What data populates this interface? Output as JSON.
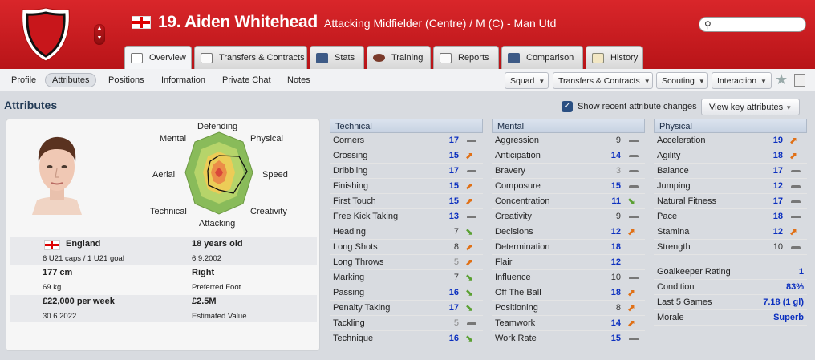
{
  "player": {
    "name": "19. Aiden Whitehead",
    "position": "Attacking Midfielder (Centre) / M (C) - Man Utd",
    "nation": "England",
    "caps": "6 U21 caps / 1 U21 goal",
    "age": "18 years old",
    "dob": "6.9.2002",
    "height": "177 cm",
    "weight": "69 kg",
    "foot": "Right",
    "foot_label": "Preferred Foot",
    "wage": "£22,000 per week",
    "contract": "30.6.2022",
    "value": "£2.5M",
    "value_label": "Estimated Value"
  },
  "tabs": [
    {
      "label": "Overview",
      "icon": "overview-icon"
    },
    {
      "label": "Transfers & Contracts",
      "icon": "document-icon"
    },
    {
      "label": "Stats",
      "icon": "stats-icon"
    },
    {
      "label": "Training",
      "icon": "training-icon"
    },
    {
      "label": "Reports",
      "icon": "reports-icon"
    },
    {
      "label": "Comparison",
      "icon": "comparison-icon"
    },
    {
      "label": "History",
      "icon": "history-icon"
    }
  ],
  "subnav": [
    "Profile",
    "Attributes",
    "Positions",
    "Information",
    "Private Chat",
    "Notes"
  ],
  "dropdowns": [
    "Squad",
    "Transfers & Contracts",
    "Scouting",
    "Interaction"
  ],
  "section_title": "Attributes",
  "show_changes_label": "Show recent attribute changes",
  "view_key_label": "View key attributes",
  "radar_labels": {
    "defending": "Defending",
    "physical": "Physical",
    "speed": "Speed",
    "creativity": "Creativity",
    "attacking": "Attacking",
    "technical": "Technical",
    "aerial": "Aerial",
    "mental": "Mental"
  },
  "technical": {
    "title": "Technical",
    "rows": [
      {
        "name": "Corners",
        "value": "17",
        "trend": "flat"
      },
      {
        "name": "Crossing",
        "value": "15",
        "trend": "up"
      },
      {
        "name": "Dribbling",
        "value": "17",
        "trend": "flat"
      },
      {
        "name": "Finishing",
        "value": "15",
        "trend": "up"
      },
      {
        "name": "First Touch",
        "value": "15",
        "trend": "up"
      },
      {
        "name": "Free Kick Taking",
        "value": "13",
        "trend": "flat"
      },
      {
        "name": "Heading",
        "value": "7",
        "trend": "down"
      },
      {
        "name": "Long Shots",
        "value": "8",
        "trend": "up"
      },
      {
        "name": "Long Throws",
        "value": "5",
        "trend": "up"
      },
      {
        "name": "Marking",
        "value": "7",
        "trend": "down"
      },
      {
        "name": "Passing",
        "value": "16",
        "trend": "down"
      },
      {
        "name": "Penalty Taking",
        "value": "17",
        "trend": "down"
      },
      {
        "name": "Tackling",
        "value": "5",
        "trend": "flat"
      },
      {
        "name": "Technique",
        "value": "16",
        "trend": "down"
      }
    ]
  },
  "mental": {
    "title": "Mental",
    "rows": [
      {
        "name": "Aggression",
        "value": "9",
        "trend": "flat"
      },
      {
        "name": "Anticipation",
        "value": "14",
        "trend": "flat"
      },
      {
        "name": "Bravery",
        "value": "3",
        "trend": "flat"
      },
      {
        "name": "Composure",
        "value": "15",
        "trend": "flat"
      },
      {
        "name": "Concentration",
        "value": "11",
        "trend": "down"
      },
      {
        "name": "Creativity",
        "value": "9",
        "trend": "flat"
      },
      {
        "name": "Decisions",
        "value": "12",
        "trend": "up"
      },
      {
        "name": "Determination",
        "value": "18",
        "trend": "none"
      },
      {
        "name": "Flair",
        "value": "12",
        "trend": "none"
      },
      {
        "name": "Influence",
        "value": "10",
        "trend": "flat"
      },
      {
        "name": "Off The Ball",
        "value": "18",
        "trend": "up"
      },
      {
        "name": "Positioning",
        "value": "8",
        "trend": "up"
      },
      {
        "name": "Teamwork",
        "value": "14",
        "trend": "up"
      },
      {
        "name": "Work Rate",
        "value": "15",
        "trend": "flat"
      }
    ]
  },
  "physical": {
    "title": "Physical",
    "rows": [
      {
        "name": "Acceleration",
        "value": "19",
        "trend": "up"
      },
      {
        "name": "Agility",
        "value": "18",
        "trend": "up"
      },
      {
        "name": "Balance",
        "value": "17",
        "trend": "flat"
      },
      {
        "name": "Jumping",
        "value": "12",
        "trend": "flat"
      },
      {
        "name": "Natural Fitness",
        "value": "17",
        "trend": "flat"
      },
      {
        "name": "Pace",
        "value": "18",
        "trend": "flat"
      },
      {
        "name": "Stamina",
        "value": "12",
        "trend": "up"
      },
      {
        "name": "Strength",
        "value": "10",
        "trend": "flat"
      }
    ],
    "extra": [
      {
        "name": "Goalkeeper Rating",
        "value": "1"
      },
      {
        "name": "Condition",
        "value": "83%"
      },
      {
        "name": "Last 5 Games",
        "value": "7.18 (1 gl)"
      },
      {
        "name": "Morale",
        "value": "Superb"
      }
    ]
  },
  "colors": {
    "header_red": "#c41c20",
    "high_value": "#0b2fbf",
    "up_arrow": "#e07016",
    "down_arrow": "#5aa032"
  }
}
